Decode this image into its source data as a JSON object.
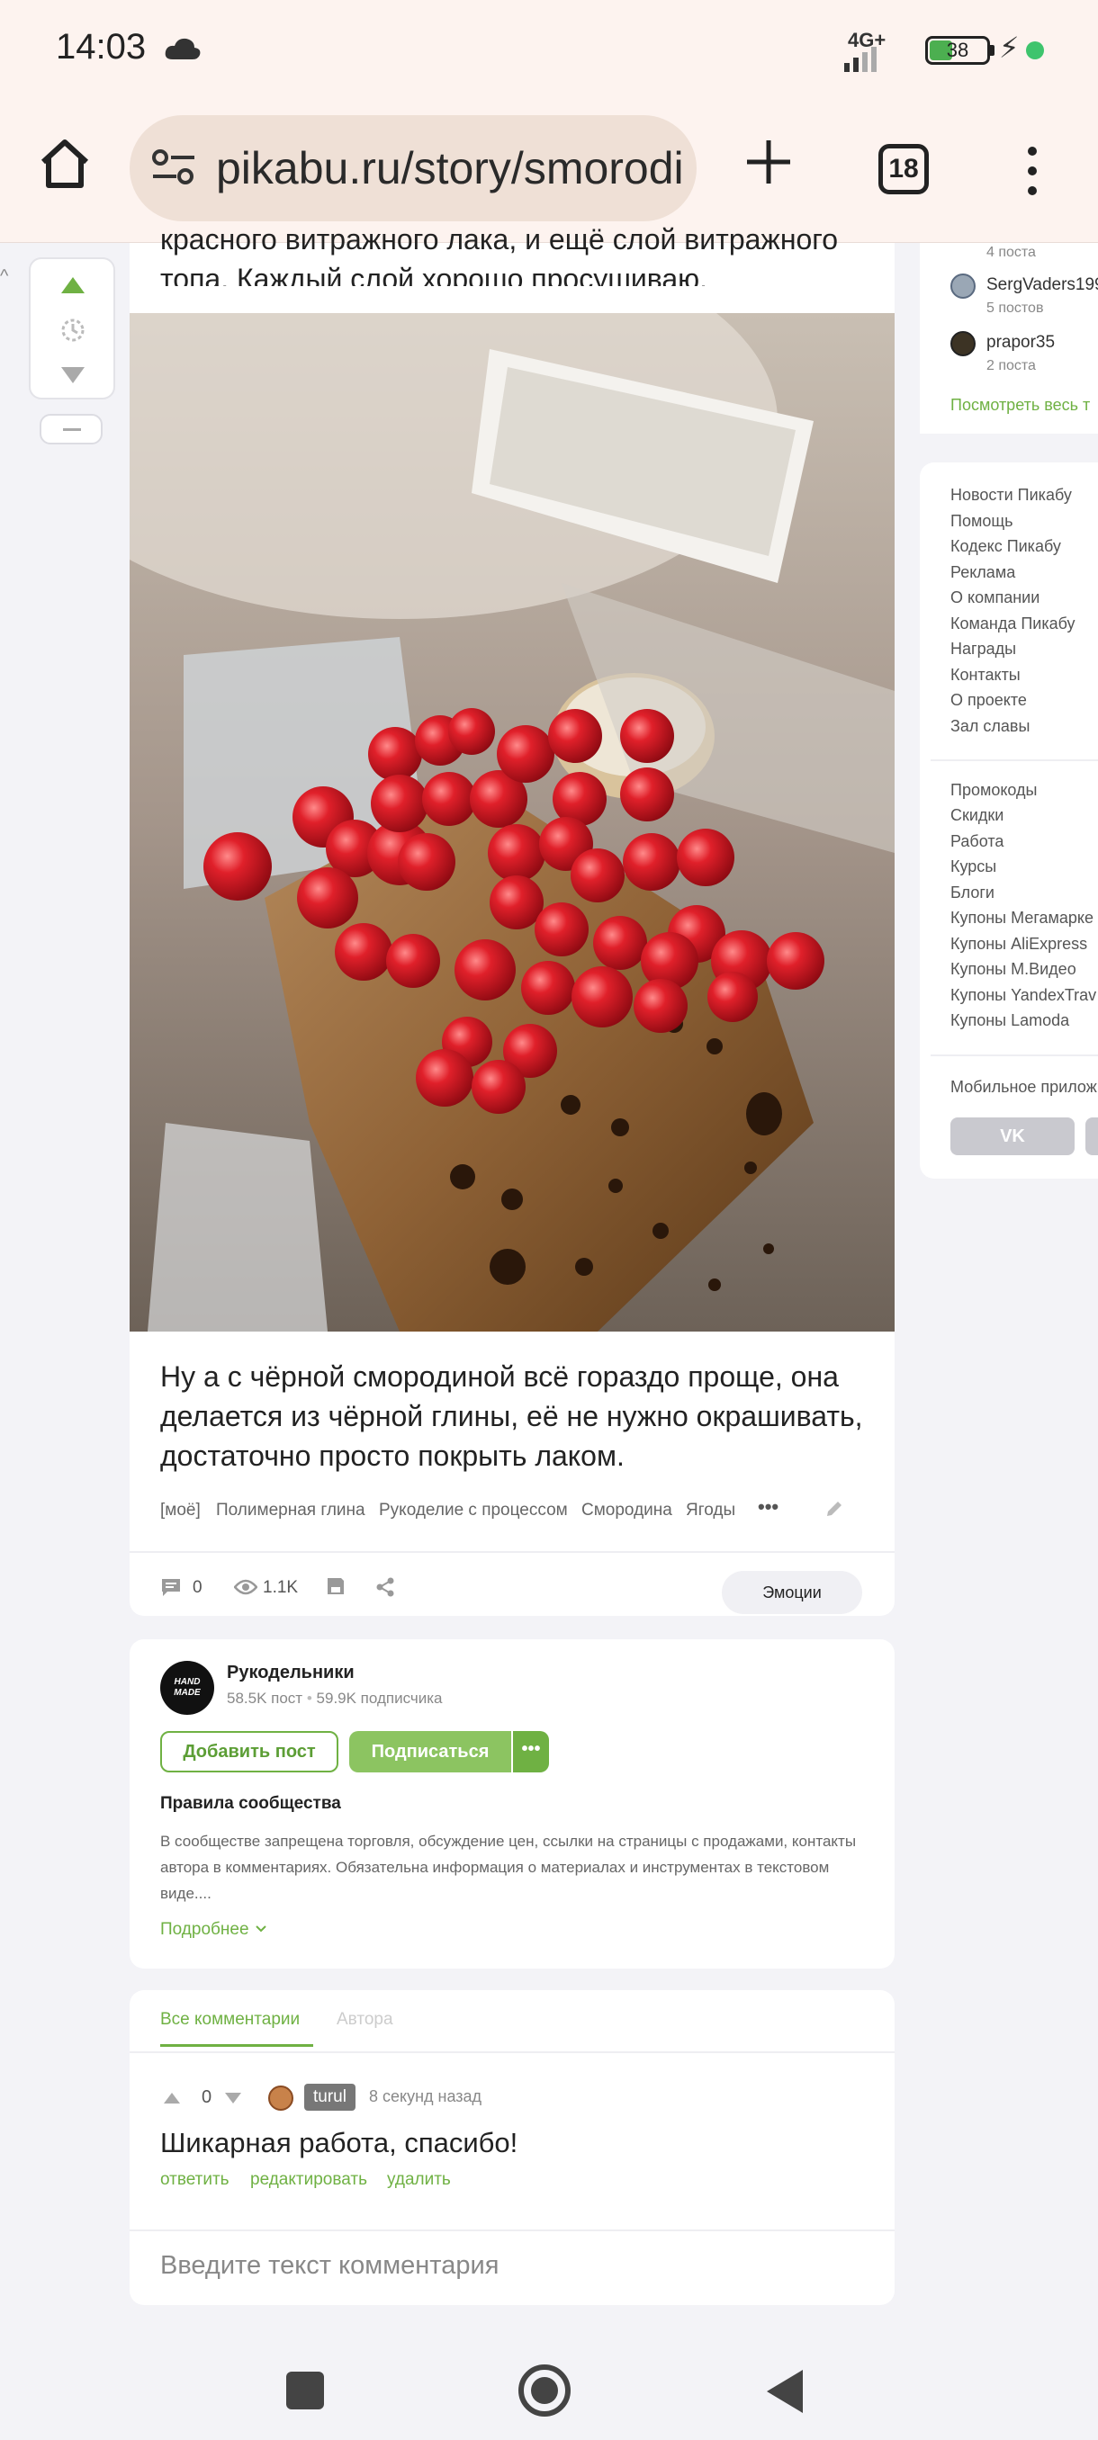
{
  "status": {
    "time": "14:03",
    "network": "4G+",
    "battery": "38"
  },
  "browser": {
    "url": "pikabu.ru/story/smorodi",
    "tab_count": "18"
  },
  "post": {
    "top_text": "красного витражного лака, и ещё слой витражного топа. Каждый слой хорошо просушиваю.",
    "caption": "Ну а с чёрной смородиной всё гораздо проще, она делается из чёрной глины, её не нужно окрашивать, достаточно просто покрыть лаком.",
    "tags": [
      "[моё]",
      "Полимерная глина",
      "Рукоделие с процессом",
      "Смородина",
      "Ягоды"
    ],
    "comments_count": "0",
    "views": "1.1K",
    "emotions_label": "Эмоции"
  },
  "community": {
    "name": "Рукодельники",
    "logo_text": "HAND MADE",
    "posts": "58.5K пост",
    "subscribers": "59.9K подписчика",
    "add_post": "Добавить пост",
    "subscribe": "Подписаться",
    "rules_title": "Правила сообщества",
    "rules_text": "В сообществе запрещена торговля, обсуждение цен, ссылки на страницы с продажами, контакты автора в комментариях. Обязательна информация о материалах и инструментах в текстовом виде....",
    "more": "Подробнее"
  },
  "comments": {
    "tab_all": "Все комментарии",
    "tab_author": "Автора",
    "comment": {
      "rating": "0",
      "user": "turul",
      "time": "8 секунд назад",
      "text": "Шикарная работа, спасибо!",
      "reply": "ответить",
      "edit": "редактировать",
      "delete": "удалить"
    },
    "input_placeholder": "Введите текст комментария"
  },
  "sidebar": {
    "authors": [
      {
        "name": "",
        "posts": "4 поста"
      },
      {
        "name": "SergVaders199",
        "posts": "5 постов"
      },
      {
        "name": "prapor35",
        "posts": "2 поста"
      }
    ],
    "see_all": "Посмотреть весь т",
    "links1": [
      "Новости Пикабу",
      "Помощь",
      "Кодекс Пикабу",
      "Реклама",
      "О компании",
      "Команда Пикабу",
      "Награды",
      "Контакты",
      "О проекте",
      "Зал славы"
    ],
    "links2": [
      "Промокоды",
      "Скидки",
      "Работа",
      "Курсы",
      "Блоги",
      "Купоны Мегамарке",
      "Купоны AliExpress",
      "Купоны М.Видео",
      "Купоны YandexTrav",
      "Купоны Lamoda"
    ],
    "mobile_app": "Мобильное прилож",
    "vk_label": "VK"
  },
  "colors": {
    "accent": "#6fb143",
    "vote_up": "#6fb143"
  }
}
